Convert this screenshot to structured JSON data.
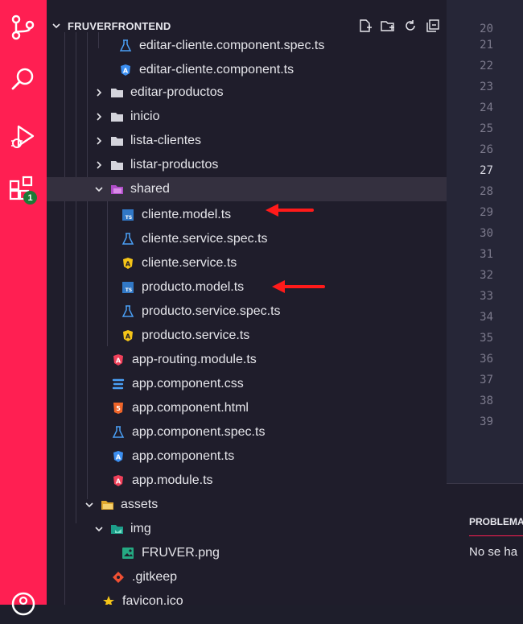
{
  "activity_bar": {
    "icons": [
      "source-control-icon",
      "search-icon",
      "run-debug-icon",
      "extensions-icon",
      "account-icon"
    ],
    "extensions_badge": "1",
    "accent_color": "#ff1f52"
  },
  "explorer": {
    "title": "FRUVERFRONTEND",
    "actions": [
      "new-file-icon",
      "new-folder-icon",
      "refresh-icon",
      "collapse-all-icon"
    ],
    "items": [
      {
        "label": "editar-cliente.component.spec.ts",
        "icon": "test-flask-icon"
      },
      {
        "label": "editar-cliente.component.ts",
        "icon": "angular-component-icon"
      },
      {
        "label": "editar-productos",
        "icon": "folder-icon"
      },
      {
        "label": "inicio",
        "icon": "folder-icon"
      },
      {
        "label": "lista-clientes",
        "icon": "folder-icon"
      },
      {
        "label": "listar-productos",
        "icon": "folder-icon"
      },
      {
        "label": "shared",
        "icon": "shared-folder-icon"
      },
      {
        "label": "cliente.model.ts",
        "icon": "typescript-icon"
      },
      {
        "label": "cliente.service.spec.ts",
        "icon": "test-flask-icon"
      },
      {
        "label": "cliente.service.ts",
        "icon": "angular-service-icon"
      },
      {
        "label": "producto.model.ts",
        "icon": "typescript-icon"
      },
      {
        "label": "producto.service.spec.ts",
        "icon": "test-flask-icon"
      },
      {
        "label": "producto.service.ts",
        "icon": "angular-service-icon"
      },
      {
        "label": "app-routing.module.ts",
        "icon": "angular-module-icon"
      },
      {
        "label": "app.component.css",
        "icon": "css-icon"
      },
      {
        "label": "app.component.html",
        "icon": "html-icon"
      },
      {
        "label": "app.component.spec.ts",
        "icon": "test-flask-icon"
      },
      {
        "label": "app.component.ts",
        "icon": "angular-component-icon"
      },
      {
        "label": "app.module.ts",
        "icon": "angular-module-icon"
      },
      {
        "label": "assets",
        "icon": "assets-folder-icon"
      },
      {
        "label": "img",
        "icon": "image-folder-icon"
      },
      {
        "label": "FRUVER.png",
        "icon": "image-file-icon"
      },
      {
        "label": ".gitkeep",
        "icon": "git-icon"
      },
      {
        "label": "favicon.ico",
        "icon": "favicon-star-icon"
      }
    ]
  },
  "editor": {
    "line_numbers": [
      "20",
      "21",
      "22",
      "23",
      "24",
      "25",
      "26",
      "27",
      "28",
      "29",
      "30",
      "31",
      "32",
      "33",
      "34",
      "35",
      "36",
      "37",
      "38",
      "39"
    ],
    "current_line": "27"
  },
  "panel": {
    "tab_label": "PROBLEMA",
    "message": "No se ha"
  },
  "annotations": {
    "arrow_color": "#ff1a1a"
  }
}
